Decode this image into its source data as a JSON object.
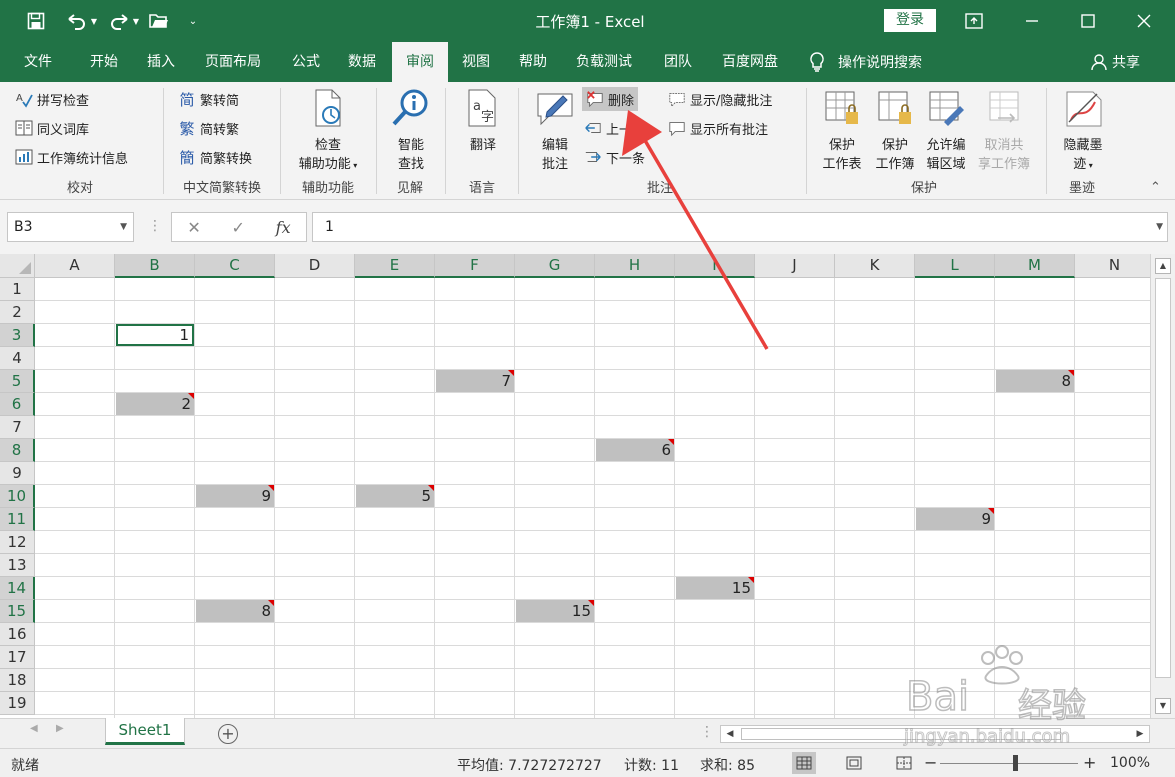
{
  "title_bar": {
    "title": "工作簿1 - Excel",
    "login_label": "登录",
    "qat_icons": [
      "save-icon",
      "undo-icon",
      "redo-icon",
      "open-icon",
      "customize-icon"
    ]
  },
  "tabs": [
    {
      "label": "文件"
    },
    {
      "label": "开始"
    },
    {
      "label": "插入"
    },
    {
      "label": "页面布局"
    },
    {
      "label": "公式"
    },
    {
      "label": "数据"
    },
    {
      "label": "审阅",
      "active": true
    },
    {
      "label": "视图"
    },
    {
      "label": "帮助"
    },
    {
      "label": "负载测试"
    },
    {
      "label": "团队"
    },
    {
      "label": "百度网盘"
    }
  ],
  "tell_me": "操作说明搜索",
  "share": "共享",
  "ribbon": {
    "proofing": {
      "label": "校对",
      "spell": "拼写检查",
      "thesaurus": "同义词库",
      "stats": "工作簿统计信息"
    },
    "chinese": {
      "label": "中文简繁转换",
      "to_simplified": "繁转简",
      "to_traditional": "简转繁",
      "convert": "简繁转换"
    },
    "accessibility": {
      "label": "辅助功能",
      "check_l1": "检查",
      "check_l2": "辅助功能"
    },
    "insights": {
      "label": "见解",
      "smart_l1": "智能",
      "smart_l2": "查找"
    },
    "language": {
      "label": "语言",
      "translate": "翻译"
    },
    "comments": {
      "label": "批注",
      "edit_l1": "编辑",
      "edit_l2": "批注",
      "delete": "删除",
      "prev": "上一条",
      "next": "下一条",
      "show_hide": "显示/隐藏批注",
      "show_all": "显示所有批注"
    },
    "protect": {
      "label": "保护",
      "sheet_l1": "保护",
      "sheet_l2": "工作表",
      "book_l1": "保护",
      "book_l2": "工作簿",
      "allow_l1": "允许编",
      "allow_l2": "辑区域",
      "unshare_l1": "取消共",
      "unshare_l2": "享工作簿"
    },
    "ink": {
      "label": "墨迹",
      "hide_l1": "隐藏墨",
      "hide_l2": "迹"
    }
  },
  "formula_bar": {
    "name_box": "B3",
    "fx": "fx",
    "value": "1"
  },
  "grid": {
    "columns": [
      "A",
      "B",
      "C",
      "D",
      "E",
      "F",
      "G",
      "H",
      "I",
      "J",
      "K",
      "L",
      "M",
      "N"
    ],
    "selected_columns": [
      "B",
      "C",
      "E",
      "F",
      "G",
      "H",
      "I",
      "L",
      "M"
    ],
    "rows": [
      "1",
      "2",
      "3",
      "4",
      "5",
      "6",
      "7",
      "8",
      "9",
      "10",
      "11",
      "12",
      "13",
      "14",
      "15",
      "16",
      "17",
      "18",
      "19"
    ],
    "selected_rows": [
      "3",
      "5",
      "6",
      "8",
      "10",
      "11",
      "14",
      "15"
    ],
    "active_cell": "B3",
    "cells": [
      {
        "col": "B",
        "row": 3,
        "value": "1",
        "comment": false,
        "active": true
      },
      {
        "col": "F",
        "row": 5,
        "value": "7",
        "comment": true
      },
      {
        "col": "M",
        "row": 5,
        "value": "8",
        "comment": true
      },
      {
        "col": "B",
        "row": 6,
        "value": "2",
        "comment": true
      },
      {
        "col": "H",
        "row": 8,
        "value": "6",
        "comment": true
      },
      {
        "col": "C",
        "row": 10,
        "value": "9",
        "comment": true
      },
      {
        "col": "E",
        "row": 10,
        "value": "5",
        "comment": true
      },
      {
        "col": "L",
        "row": 11,
        "value": "9",
        "comment": true
      },
      {
        "col": "I",
        "row": 14,
        "value": "15",
        "comment": true
      },
      {
        "col": "C",
        "row": 15,
        "value": "8",
        "comment": true
      },
      {
        "col": "G",
        "row": 15,
        "value": "15",
        "comment": true
      }
    ]
  },
  "sheet_tabs": [
    {
      "label": "Sheet1",
      "active": true
    }
  ],
  "status_bar": {
    "ready": "就绪",
    "average": "平均值: 7.727272727",
    "count": "计数: 11",
    "sum": "求和: 85",
    "zoom": "100%",
    "zoom_level_percent": 100
  },
  "watermark": {
    "brand": "Bai",
    "brand_suffix": "经验",
    "url": "jingyan.baidu.com"
  },
  "colors": {
    "accent": "#217346",
    "comment_marker": "#dd0000",
    "annotation_arrow": "#e8403c"
  }
}
